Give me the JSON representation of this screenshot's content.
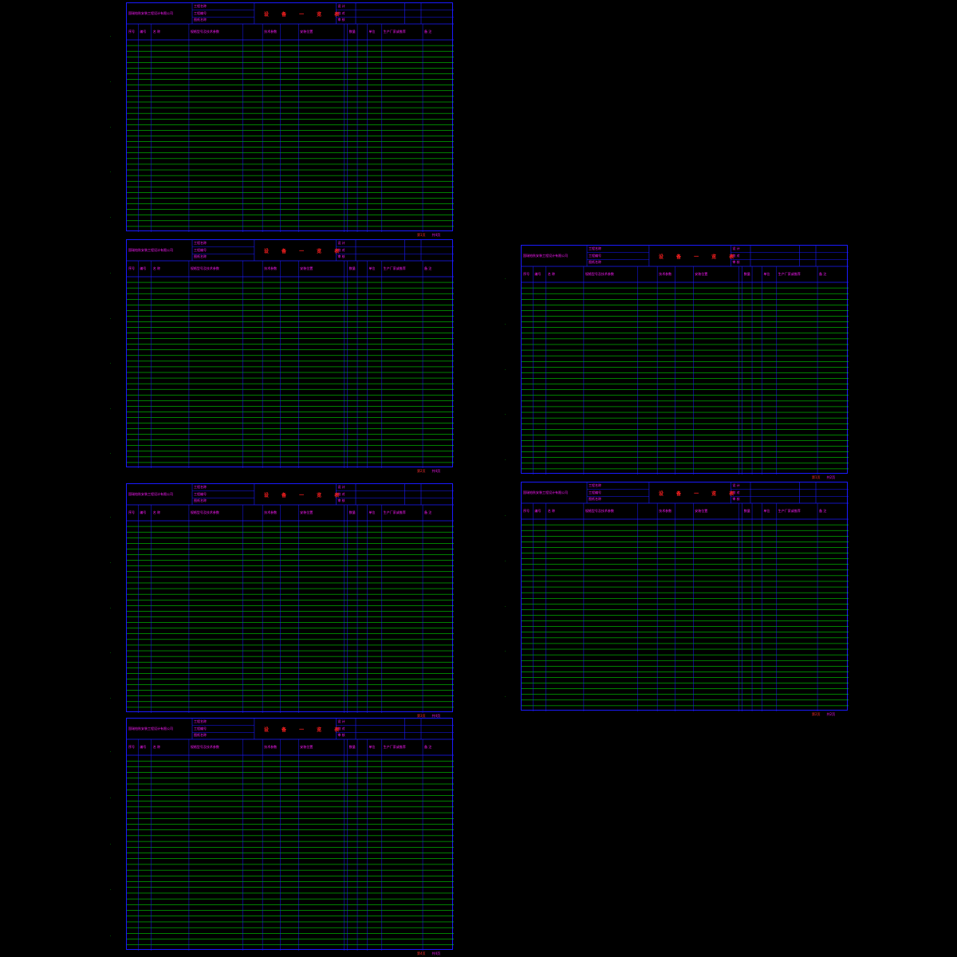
{
  "document": {
    "sheet_title": "设 备 一 览 表",
    "company": "国瑞铂秋安装工程设计有限公司",
    "titleblock_labels": [
      "工程名称",
      "工程编号",
      "图纸名称"
    ],
    "titleblock_right": [
      "设 计",
      "校 对",
      "审 核"
    ],
    "header_columns": [
      "序号",
      "编号",
      "名 称",
      "规格型号及技术参数",
      "技术参数",
      "安装位置",
      "数量",
      "单位",
      "生产厂家或推荐",
      "备 注"
    ],
    "page_labels": [
      {
        "cur": "第1页",
        "total": "共4页"
      },
      {
        "cur": "第2页",
        "total": "共4页"
      },
      {
        "cur": "第3页",
        "total": "共4页"
      },
      {
        "cur": "第4页",
        "total": "共4页"
      },
      {
        "cur": "第1页",
        "total": "共2页"
      },
      {
        "cur": "第2页",
        "total": "共2页"
      }
    ]
  },
  "colors": {
    "background": "#000000",
    "grid": "#00ff00",
    "frame": "#1a1aff",
    "text": "#ff1aff",
    "title": "#ff2020",
    "accent_red": "#ff3030"
  }
}
